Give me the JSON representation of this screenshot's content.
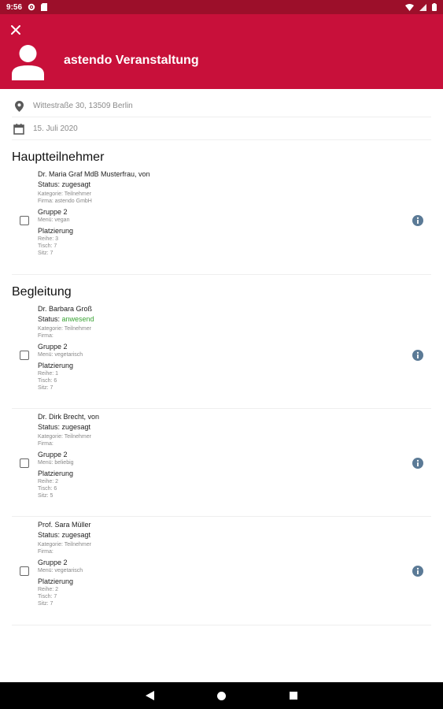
{
  "status_bar": {
    "time": "9:56"
  },
  "header": {
    "title": "astendo Veranstaltung"
  },
  "event": {
    "address": "Wittestraße 30, 13509 Berlin",
    "date": "15. Juli 2020"
  },
  "sections": {
    "main_title": "Hauptteilnehmer",
    "companion_title": "Begleitung"
  },
  "participants": [
    {
      "name": "Dr. Maria Graf MdB Musterfrau, von",
      "status_label": "Status:",
      "status_value": "zugesagt",
      "category": "Kategorie: Teilnehmer",
      "company": "Firma: astendo GmbH",
      "group": "Gruppe 2",
      "menu": "Menü: vegan",
      "placement_label": "Platzierung",
      "row": "Reihe: 3",
      "table": "Tisch: 7",
      "seat": "Sitz: 7",
      "checked": false
    },
    {
      "name": "Dr. Barbara Groß",
      "status_label": "Status:",
      "status_value": "anwesend",
      "category": "Kategorie: Teilnehmer",
      "company": "Firma:",
      "group": "Gruppe 2",
      "menu": "Menü: vegetarisch",
      "placement_label": "Platzierung",
      "row": "Reihe: 1",
      "table": "Tisch: 6",
      "seat": "Sitz: 7",
      "checked": false
    },
    {
      "name": "Dr. Dirk Brecht, von",
      "status_label": "Status:",
      "status_value": "zugesagt",
      "category": "Kategorie: Teilnehmer",
      "company": "Firma:",
      "group": "Gruppe 2",
      "menu": "Menü: beliebig",
      "placement_label": "Platzierung",
      "row": "Reihe: 2",
      "table": "Tisch: 6",
      "seat": "Sitz: 5",
      "checked": false
    },
    {
      "name": "Prof. Sara Müller",
      "status_label": "Status:",
      "status_value": "zugesagt",
      "category": "Kategorie: Teilnehmer",
      "company": "Firma:",
      "group": "Gruppe 2",
      "menu": "Menü: vegetarisch",
      "placement_label": "Platzierung",
      "row": "Reihe: 2",
      "table": "Tisch: 7",
      "seat": "Sitz: 7",
      "checked": false
    }
  ],
  "colors": {
    "header": "#c8103a",
    "status_bar": "#9c0f2a",
    "present_status": "#3aa335",
    "info_icon": "#5b7a96"
  },
  "icons": {
    "close": "close-icon",
    "avatar": "person-icon",
    "location": "location-pin-icon",
    "calendar": "calendar-icon",
    "info": "info-icon"
  }
}
